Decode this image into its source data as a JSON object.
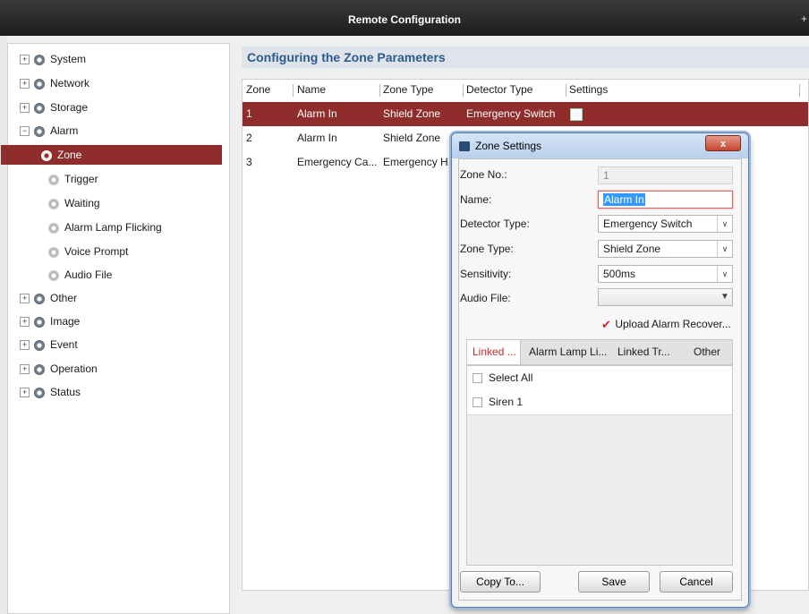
{
  "window": {
    "title": "Remote Configuration",
    "pin_glyph": "+"
  },
  "sidebar": {
    "items": [
      {
        "label": "System",
        "expander": "+"
      },
      {
        "label": "Network",
        "expander": "+"
      },
      {
        "label": "Storage",
        "expander": "+"
      },
      {
        "label": "Alarm",
        "expander": "−"
      },
      {
        "label": "Zone"
      },
      {
        "label": "Trigger"
      },
      {
        "label": "Waiting"
      },
      {
        "label": "Alarm Lamp Flicking"
      },
      {
        "label": "Voice Prompt"
      },
      {
        "label": "Audio File"
      },
      {
        "label": "Other",
        "expander": "+"
      },
      {
        "label": "Image",
        "expander": "+"
      },
      {
        "label": "Event",
        "expander": "+"
      },
      {
        "label": "Operation",
        "expander": "+"
      },
      {
        "label": "Status",
        "expander": "+"
      }
    ]
  },
  "main": {
    "section_title": "Configuring the Zone Parameters",
    "columns": [
      "Zone",
      "Name",
      "Zone Type",
      "Detector Type",
      "Settings"
    ],
    "rows": [
      {
        "zone": "1",
        "name": "Alarm In",
        "zone_type": "Shield Zone",
        "detector_type": "Emergency Switch"
      },
      {
        "zone": "2",
        "name": "Alarm In",
        "zone_type": "Shield Zone",
        "detector_type": ""
      },
      {
        "zone": "3",
        "name": "Emergency Ca...",
        "zone_type": "Emergency H...",
        "detector_type": ""
      }
    ]
  },
  "dialog": {
    "title": "Zone Settings",
    "close_glyph": "x",
    "zone_no_label": "Zone No.:",
    "zone_no_value": "1",
    "name_label": "Name:",
    "name_value": "Alarm In",
    "detector_type_label": "Detector Type:",
    "detector_type_value": "Emergency Switch",
    "zone_type_label": "Zone Type:",
    "zone_type_value": "Shield Zone",
    "sensitivity_label": "Sensitivity:",
    "sensitivity_value": "500ms",
    "audio_file_label": "Audio File:",
    "audio_file_value": "",
    "upload_label": "Upload Alarm Recover...",
    "upload_checked": true,
    "tabs": [
      "Linked ...",
      "Alarm Lamp Li...",
      "Linked Tr...",
      "Other"
    ],
    "select_all_label": "Select All",
    "list_items": [
      "Siren 1"
    ],
    "copy_button": "Copy To...",
    "save_button": "Save",
    "cancel_button": "Cancel"
  },
  "colors": {
    "selection": "#8f2d2c",
    "section_title": "#2f5a8c",
    "active_tab": "#c62828"
  },
  "icons": [
    "gear-icon",
    "expand-icon",
    "collapse-icon",
    "edit-icon",
    "checkbox-icon",
    "check-icon",
    "dropdown-arrow-icon",
    "close-icon"
  ]
}
